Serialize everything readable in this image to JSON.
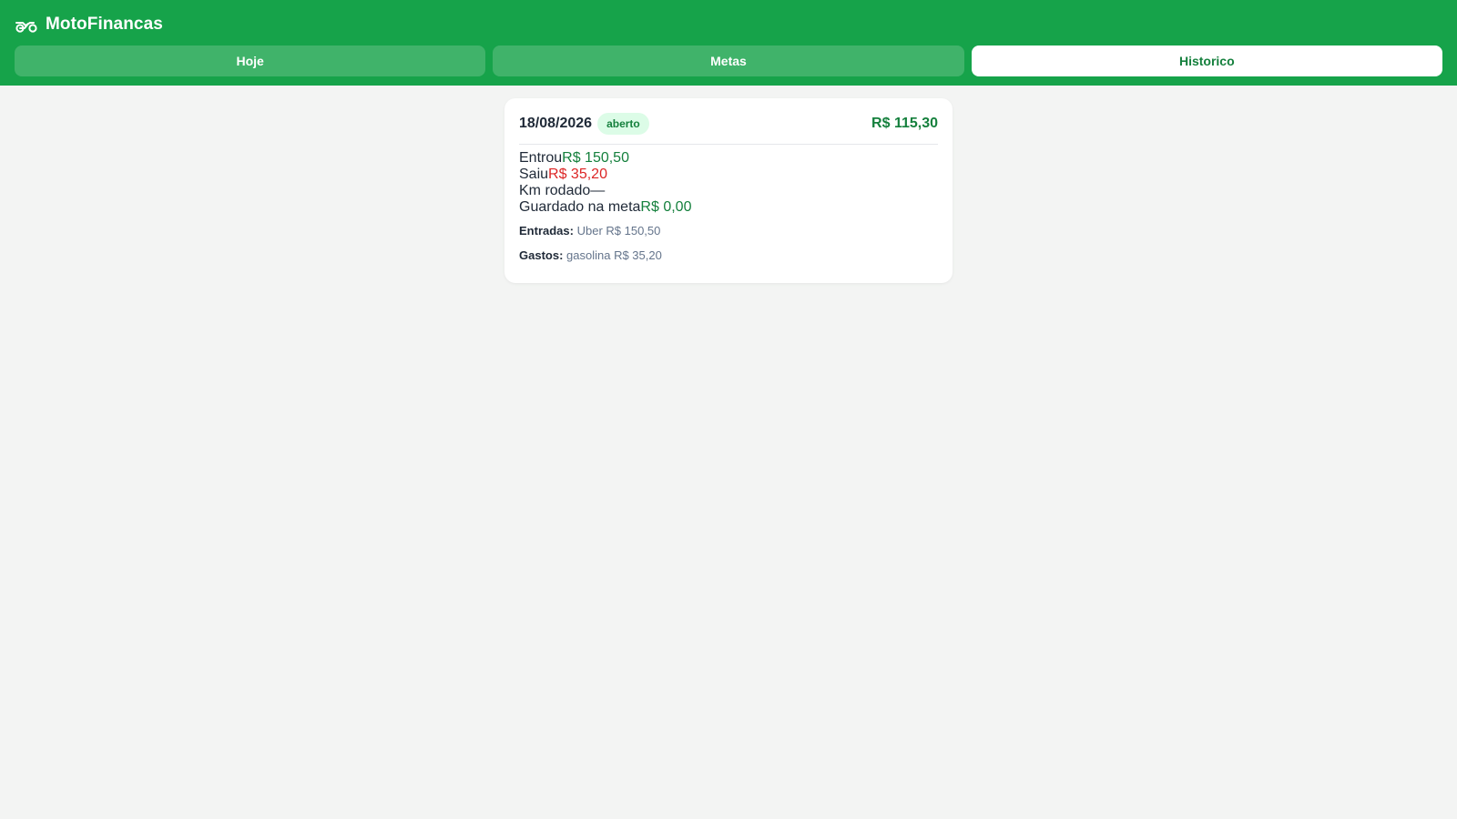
{
  "app": {
    "title": "MotoFinancas",
    "icon": "motorcycle-icon"
  },
  "tabs": [
    {
      "label": "Hoje",
      "active": false
    },
    {
      "label": "Metas",
      "active": false
    },
    {
      "label": "Historico",
      "active": true
    }
  ],
  "card": {
    "date": "18/08/2026",
    "status": "aberto",
    "total": "R$ 115,30",
    "rows": [
      {
        "label": "Entrou",
        "value": "R$ 150,50",
        "color": "#15803d"
      },
      {
        "label": "Saiu",
        "value": "R$ 35,20",
        "color": "#dc2626"
      },
      {
        "label": "Km rodado",
        "value": "—"
      },
      {
        "label": "Guardado na meta",
        "value": "R$ 0,00",
        "color": "#15803d"
      }
    ],
    "entradas": {
      "label": "Entradas:",
      "text": "Uber R$ 150,50"
    },
    "gastos": {
      "label": "Gastos:",
      "text": "gasolina R$ 35,20"
    }
  },
  "colors": {
    "brand": "#16a34a",
    "accent_dark": "#15803d",
    "negative": "#dc2626",
    "background": "#f3f4f3"
  }
}
